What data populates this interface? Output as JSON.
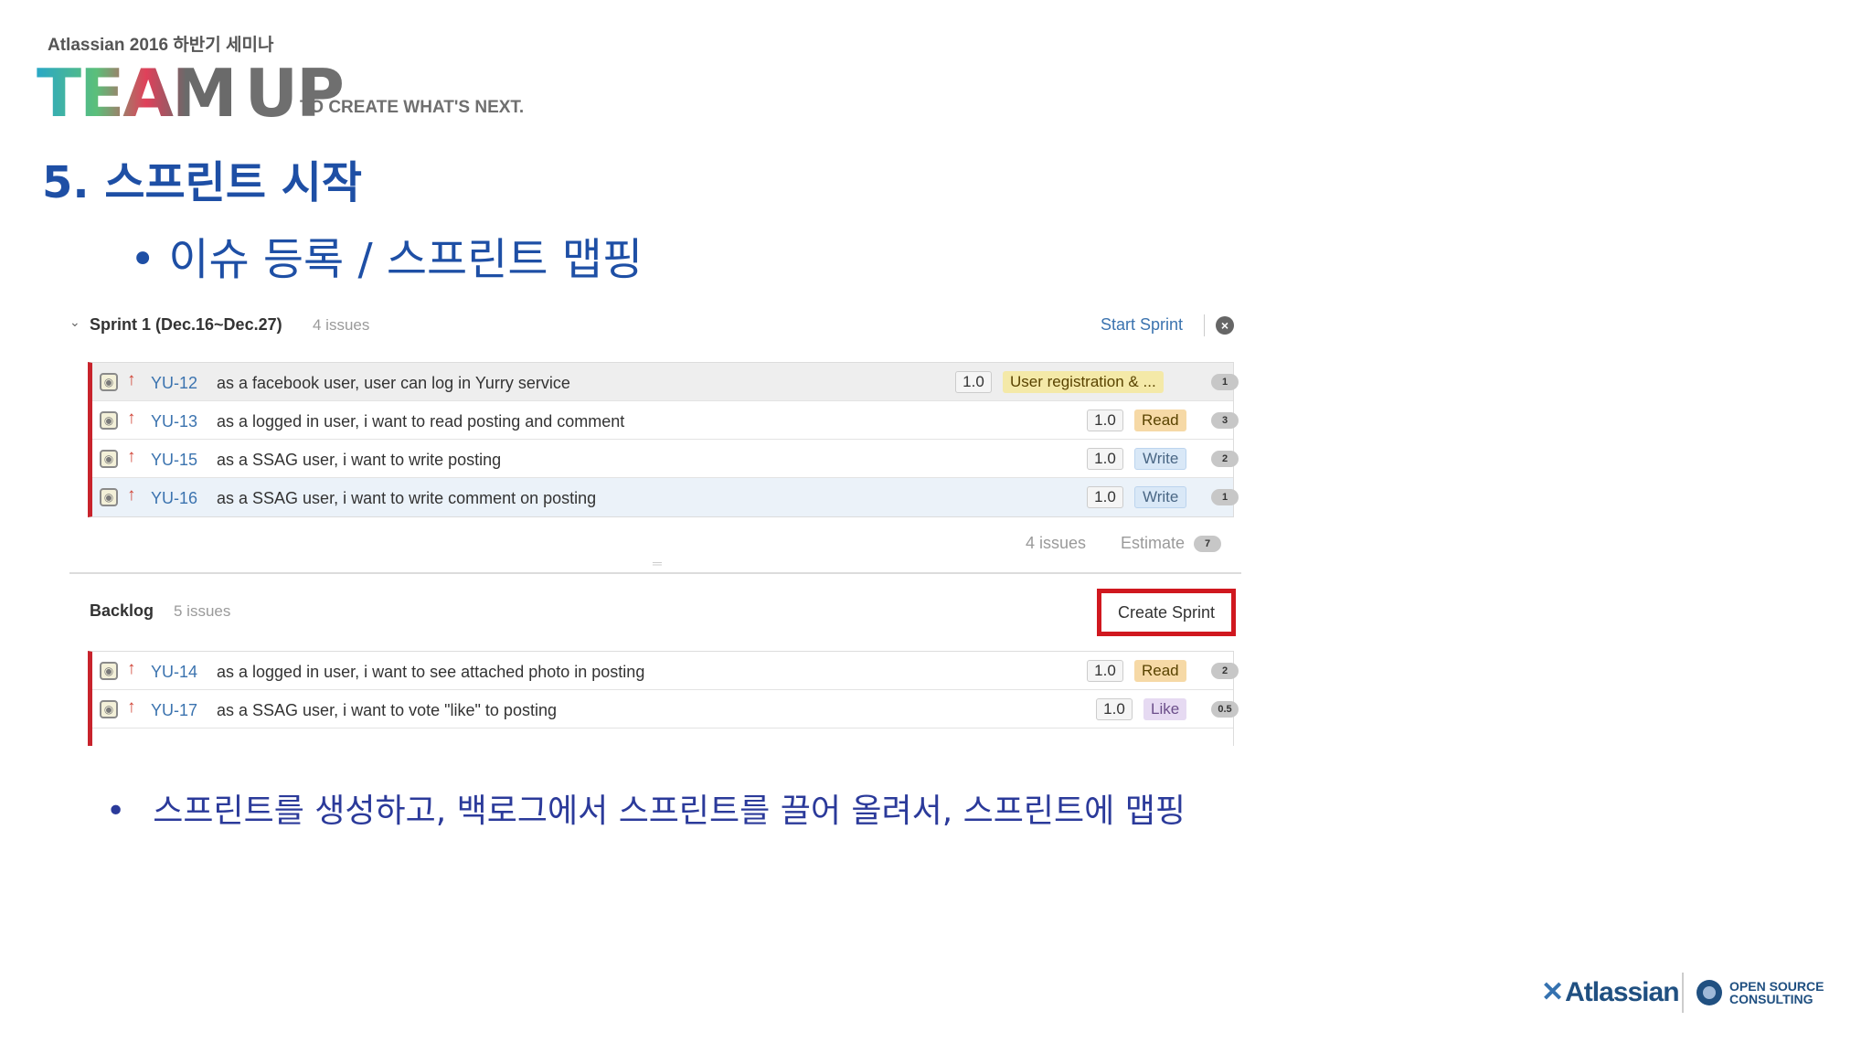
{
  "header": {
    "seminar": "Atlassian 2016 하반기 세미나",
    "logo_team": "TEAM",
    "logo_up": "UP",
    "tagline": "TO CREATE WHAT'S NEXT.",
    "heading": "5. 스프린트 시작",
    "subbullet": "이슈 등록 / 스프린트 맵핑"
  },
  "sprint": {
    "name": "Sprint 1 (Dec.16~Dec.27)",
    "count": "4 issues",
    "start_label": "Start Sprint",
    "issues": [
      {
        "key": "YU-12",
        "summary": "as a facebook user, user can log in Yurry service",
        "estimate": "1.0",
        "epic": "User registration & ...",
        "epic_color": "yellow",
        "badge": "1"
      },
      {
        "key": "YU-13",
        "summary": "as a logged in user, i want to read posting and comment",
        "estimate": "1.0",
        "epic": "Read",
        "epic_color": "orange",
        "badge": "3"
      },
      {
        "key": "YU-15",
        "summary": "as a SSAG user, i want to write posting",
        "estimate": "1.0",
        "epic": "Write",
        "epic_color": "blue",
        "badge": "2"
      },
      {
        "key": "YU-16",
        "summary": "as a SSAG user, i want to write comment on posting",
        "estimate": "1.0",
        "epic": "Write",
        "epic_color": "blue",
        "badge": "1"
      }
    ],
    "footer_issues": "4 issues",
    "footer_estimate_label": "Estimate",
    "footer_estimate": "7"
  },
  "backlog": {
    "title": "Backlog",
    "count": "5 issues",
    "create_label": "Create Sprint",
    "issues": [
      {
        "key": "YU-14",
        "summary": "as a logged in user, i want to see attached photo in posting",
        "estimate": "1.0",
        "epic": "Read",
        "epic_color": "orange",
        "badge": "2"
      },
      {
        "key": "YU-17",
        "summary": "as a SSAG user, i want to vote \"like\" to posting",
        "estimate": "1.0",
        "epic": "Like",
        "epic_color": "purple",
        "badge": "0.5"
      }
    ]
  },
  "bottom_bullet": "스프린트를 생성하고, 백로그에서 스프린트를 끌어 올려서, 스프린트에 맵핑",
  "footer": {
    "atlassian": "Atlassian",
    "osc_line1": "OPEN SOURCE",
    "osc_line2": "CONSULTING"
  },
  "icons": {
    "issue_type": "story-icon",
    "priority": "arrow-up-priority-icon",
    "close": "close-circle-icon",
    "chevron": "chevron-down-icon"
  },
  "colors": {
    "heading_blue": "#1e4fa5",
    "sprint_red_border": "#c8232c",
    "create_sprint_highlight": "#d0181f",
    "link_blue": "#3b73af"
  }
}
